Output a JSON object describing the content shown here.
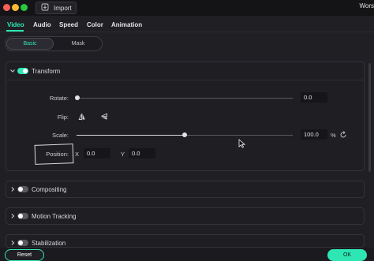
{
  "titlebar": {
    "import_label": "Import",
    "window_title_fragment": "Wors"
  },
  "tabs": [
    {
      "label": "Video",
      "active": true
    },
    {
      "label": "Audio",
      "active": false
    },
    {
      "label": "Speed",
      "active": false
    },
    {
      "label": "Color",
      "active": false
    },
    {
      "label": "Animation",
      "active": false
    }
  ],
  "segment": {
    "basic": "Basic",
    "mask": "Mask",
    "selected": "Basic"
  },
  "transform": {
    "title": "Transform",
    "enabled": true,
    "rotate": {
      "label": "Rotate:",
      "value": "0.0",
      "fraction": 0.0
    },
    "flip": {
      "label": "Flip:"
    },
    "scale": {
      "label": "Scale:",
      "value": "100.0",
      "unit": "%",
      "fraction": 0.5
    },
    "position": {
      "label": "Position:",
      "x_label": "X",
      "x_value": "0.0",
      "y_label": "Y",
      "y_value": "0.0"
    }
  },
  "sections": [
    {
      "label": "Compositing",
      "enabled": false
    },
    {
      "label": "Motion Tracking",
      "enabled": false
    },
    {
      "label": "Stabilization",
      "enabled": false
    }
  ],
  "footer": {
    "reset_label": "Reset",
    "ok_label": "OK"
  },
  "colors": {
    "accent": "#2ee6b4",
    "background": "#1f1f24",
    "panel": "#1e1e23"
  },
  "icons": {
    "import": "import-icon",
    "flip_horizontal": "flip-horizontal-icon",
    "flip_vertical": "flip-vertical-icon",
    "reset_scale": "reset-icon",
    "chevron_down": "chevron-down-icon",
    "chevron_right": "chevron-right-icon",
    "cursor": "mouse-cursor-icon"
  }
}
